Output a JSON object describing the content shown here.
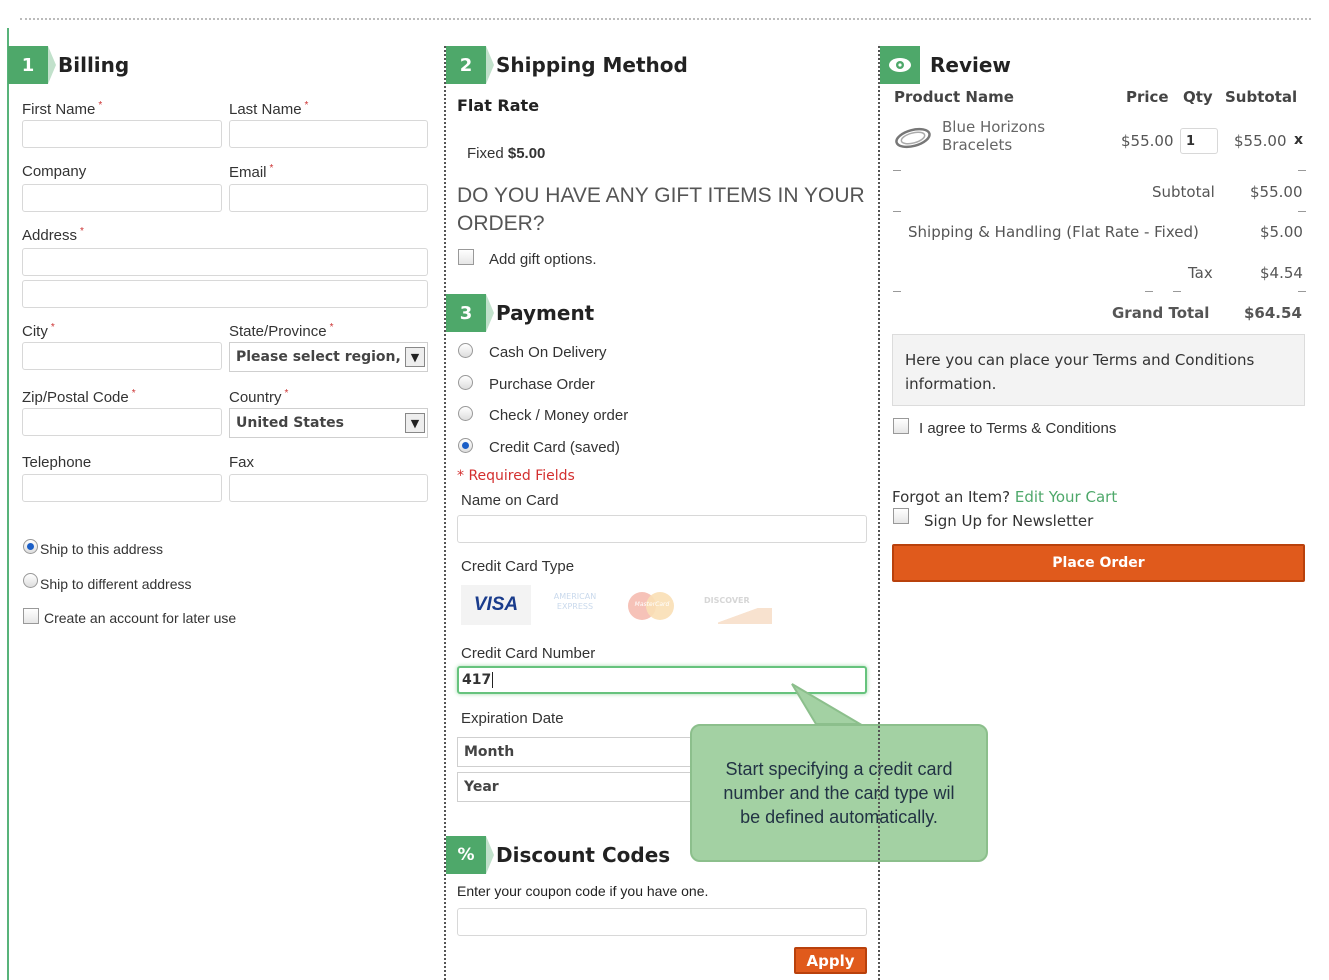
{
  "billing": {
    "step": "1",
    "title": "Billing",
    "fields": {
      "first_name": "First Name",
      "last_name": "Last Name",
      "company": "Company",
      "email": "Email",
      "address": "Address",
      "city": "City",
      "state": "State/Province",
      "state_value": "Please select region,",
      "zip": "Zip/Postal Code",
      "country": "Country",
      "country_value": "United States",
      "telephone": "Telephone",
      "fax": "Fax"
    },
    "required_mark": "*",
    "ship_same": "Ship to this address",
    "ship_diff": "Ship to different address",
    "create_account": "Create an account for later use"
  },
  "shipping": {
    "step": "2",
    "title": "Shipping Method",
    "method": "Flat Rate",
    "fixed_label": "Fixed",
    "fixed_price": "$5.00",
    "gift_question": "DO YOU HAVE ANY GIFT ITEMS IN YOUR ORDER?",
    "gift_option": "Add gift options."
  },
  "payment": {
    "step": "3",
    "title": "Payment",
    "options": [
      "Cash On Delivery",
      "Purchase Order",
      "Check / Money order",
      "Credit Card (saved)"
    ],
    "required_note": "* Required Fields",
    "name_on_card": "Name on Card",
    "card_type": "Credit Card Type",
    "card_logos": [
      "VISA",
      "AMERICAN EXPRESS",
      "MasterCard",
      "DISCOVER"
    ],
    "card_number_label": "Credit Card Number",
    "card_number_value": "417",
    "expiration": "Expiration Date",
    "month": "Month",
    "year": "Year"
  },
  "tooltip": "Start specifying a credit card number and the card type wil be defined automatically.",
  "discount": {
    "step": "%",
    "title": "Discount Codes",
    "hint": "Enter your coupon code if you have one.",
    "apply": "Apply"
  },
  "review": {
    "title": "Review",
    "headers": {
      "product": "Product Name",
      "price": "Price",
      "qty": "Qty",
      "subtotal": "Subtotal"
    },
    "item": {
      "name": "Blue Horizons Bracelets",
      "price": "$55.00",
      "qty": "1",
      "subtotal": "$55.00",
      "remove": "x"
    },
    "totals": [
      {
        "label": "Subtotal",
        "value": "$55.00"
      },
      {
        "label": "Shipping & Handling (Flat Rate - Fixed)",
        "value": "$5.00"
      },
      {
        "label": "Tax",
        "value": "$4.54"
      }
    ],
    "grand_total_label": "Grand Total",
    "grand_total_value": "$64.54",
    "terms_text": "Here you can place your Terms and Conditions information.",
    "agree": "I agree to Terms & Conditions",
    "forgot": "Forgot an Item?",
    "edit_cart": "Edit Your Cart",
    "newsletter": "Sign Up for Newsletter",
    "place_order": "Place Order"
  },
  "colors": {
    "accent": "#4ea86a",
    "order_button": "#e05a1c",
    "link": "#4ea86a",
    "required": "#d32f2f",
    "tooltip": "#a3d1a3"
  }
}
